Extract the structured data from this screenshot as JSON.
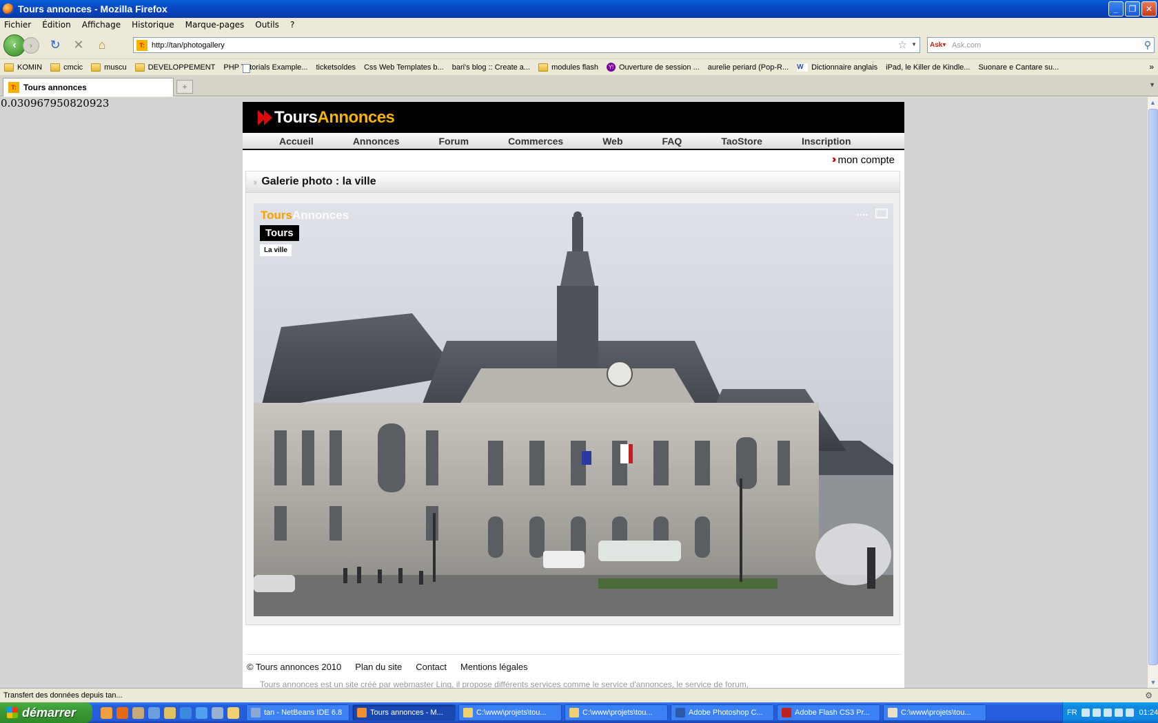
{
  "window": {
    "title": "Tours annonces - Mozilla Firefox"
  },
  "menu": [
    "Fichier",
    "Édition",
    "Affichage",
    "Historique",
    "Marque-pages",
    "Outils",
    "?"
  ],
  "navbar": {
    "url": "http://tan/photogallery",
    "search_placeholder": "Ask.com"
  },
  "bookmarks": [
    {
      "type": "folder",
      "label": "KOMIN"
    },
    {
      "type": "folder",
      "label": "cmcic"
    },
    {
      "type": "folder",
      "label": "muscu"
    },
    {
      "type": "folder",
      "label": "DEVELOPPEMENT"
    },
    {
      "type": "page",
      "label": "PHP Tutorials Example..."
    },
    {
      "type": "page",
      "label": "ticketsoldes"
    },
    {
      "type": "page",
      "label": "Css Web Templates b..."
    },
    {
      "type": "page",
      "label": "bari's blog :: Create a..."
    },
    {
      "type": "folder",
      "label": "modules flash"
    },
    {
      "type": "yahoo",
      "label": "Ouverture de session ..."
    },
    {
      "type": "page",
      "label": "aurelie periard (Pop-R..."
    },
    {
      "type": "wr",
      "label": "Dictionnaire anglais"
    },
    {
      "type": "page",
      "label": "iPad, le Killer de Kindle..."
    },
    {
      "type": "page",
      "label": "Suonare e Cantare su..."
    }
  ],
  "tab": {
    "label": "Tours annonces"
  },
  "debug_value": "0.030967950820923",
  "site": {
    "logo_part1": "Tours",
    "logo_part2": "Annonces",
    "nav": [
      "Accueil",
      "Annonces",
      "Forum",
      "Commerces",
      "Web",
      "FAQ",
      "TaoStore",
      "Inscription"
    ],
    "account_label": "mon compte",
    "gallery_title": "Galerie photo : la ville",
    "photo": {
      "logo_part1": "Tours",
      "logo_part2": "Annonces",
      "city": "Tours",
      "category": "La ville"
    },
    "footer": {
      "copyright": "© Tours annonces 2010",
      "links": [
        "Plan du site",
        "Contact",
        "Mentions légales"
      ],
      "description": "Tours annonces est un site créé par webmaster Ling, il propose différents services comme le service d'annonces, le service de forum,"
    }
  },
  "status": {
    "text": "Transfert des données depuis tan..."
  },
  "taskbar": {
    "start_label": "démarrer",
    "tasks": [
      {
        "label": "tan - NetBeans IDE 6.8",
        "color": "#8aa8d8"
      },
      {
        "label": "Tours annonces - M...",
        "color": "#f09030",
        "active": true
      },
      {
        "label": "C:\\www\\projets\\tou...",
        "color": "#f0d070"
      },
      {
        "label": "C:\\www\\projets\\tou...",
        "color": "#f0d070"
      },
      {
        "label": "Adobe Photoshop C...",
        "color": "#2a5aa8"
      },
      {
        "label": "Adobe Flash CS3 Pr...",
        "color": "#c02020"
      },
      {
        "label": "C:\\www\\projets\\tou...",
        "color": "#e8e0c0"
      }
    ],
    "lang": "FR",
    "clock": "01:24"
  }
}
